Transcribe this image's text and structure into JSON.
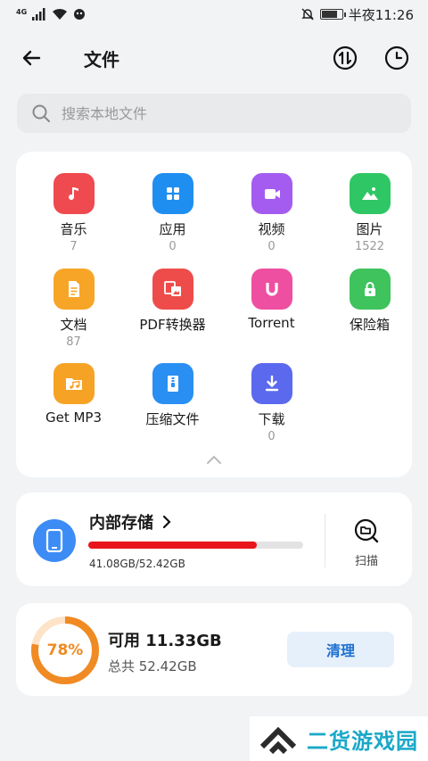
{
  "status_bar": {
    "network": "4G",
    "time": "半夜11:26"
  },
  "header": {
    "title": "文件"
  },
  "search": {
    "placeholder": "搜索本地文件"
  },
  "categories": [
    {
      "label": "音乐",
      "count": "7",
      "color": "#ef4a4f",
      "icon": "music-icon"
    },
    {
      "label": "应用",
      "count": "0",
      "color": "#1f8ef1",
      "icon": "apps-icon"
    },
    {
      "label": "视频",
      "count": "0",
      "color": "#a45cf0",
      "icon": "video-icon"
    },
    {
      "label": "图片",
      "count": "1522",
      "color": "#2fc765",
      "icon": "image-icon"
    },
    {
      "label": "文档",
      "count": "87",
      "color": "#f7a526",
      "icon": "document-icon"
    },
    {
      "label": "PDF转换器",
      "count": "",
      "color": "#ee4c4a",
      "icon": "pdf-converter-icon"
    },
    {
      "label": "Torrent",
      "count": "",
      "color": "#ee4fa1",
      "icon": "magnet-icon"
    },
    {
      "label": "保险箱",
      "count": "",
      "color": "#3ec35d",
      "icon": "lock-icon"
    },
    {
      "label": "Get MP3",
      "count": "",
      "color": "#f6a325",
      "icon": "mp3-icon"
    },
    {
      "label": "压缩文件",
      "count": "",
      "color": "#2a8ff3",
      "icon": "zip-icon"
    },
    {
      "label": "下载",
      "count": "0",
      "color": "#5b69ee",
      "icon": "download-icon"
    }
  ],
  "storage": {
    "title": "内部存储",
    "usage": "41.08GB/52.42GB",
    "used_fraction": 0.784,
    "scan_label": "扫描"
  },
  "available": {
    "percent_label": "78%",
    "percent": 78,
    "title": "可用 11.33GB",
    "total": "总共 52.42GB",
    "clean_label": "清理"
  },
  "watermark": {
    "text": "二货游戏园"
  },
  "colors": {
    "accent": "#1c6fd1",
    "storage_fill": "#e8151b",
    "ring": "#f08a23"
  }
}
